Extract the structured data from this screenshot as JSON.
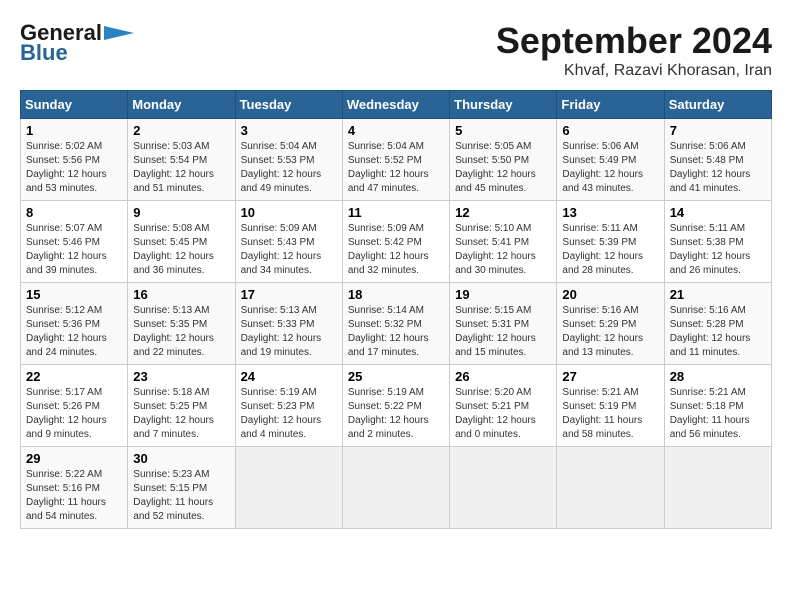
{
  "logo": {
    "general": "General",
    "blue": "Blue"
  },
  "title": "September 2024",
  "subtitle": "Khvaf, Razavi Khorasan, Iran",
  "days_header": [
    "Sunday",
    "Monday",
    "Tuesday",
    "Wednesday",
    "Thursday",
    "Friday",
    "Saturday"
  ],
  "weeks": [
    [
      {
        "day": "1",
        "sunrise": "5:02 AM",
        "sunset": "5:56 PM",
        "daylight": "12 hours and 53 minutes."
      },
      {
        "day": "2",
        "sunrise": "5:03 AM",
        "sunset": "5:54 PM",
        "daylight": "12 hours and 51 minutes."
      },
      {
        "day": "3",
        "sunrise": "5:04 AM",
        "sunset": "5:53 PM",
        "daylight": "12 hours and 49 minutes."
      },
      {
        "day": "4",
        "sunrise": "5:04 AM",
        "sunset": "5:52 PM",
        "daylight": "12 hours and 47 minutes."
      },
      {
        "day": "5",
        "sunrise": "5:05 AM",
        "sunset": "5:50 PM",
        "daylight": "12 hours and 45 minutes."
      },
      {
        "day": "6",
        "sunrise": "5:06 AM",
        "sunset": "5:49 PM",
        "daylight": "12 hours and 43 minutes."
      },
      {
        "day": "7",
        "sunrise": "5:06 AM",
        "sunset": "5:48 PM",
        "daylight": "12 hours and 41 minutes."
      }
    ],
    [
      {
        "day": "8",
        "sunrise": "5:07 AM",
        "sunset": "5:46 PM",
        "daylight": "12 hours and 39 minutes."
      },
      {
        "day": "9",
        "sunrise": "5:08 AM",
        "sunset": "5:45 PM",
        "daylight": "12 hours and 36 minutes."
      },
      {
        "day": "10",
        "sunrise": "5:09 AM",
        "sunset": "5:43 PM",
        "daylight": "12 hours and 34 minutes."
      },
      {
        "day": "11",
        "sunrise": "5:09 AM",
        "sunset": "5:42 PM",
        "daylight": "12 hours and 32 minutes."
      },
      {
        "day": "12",
        "sunrise": "5:10 AM",
        "sunset": "5:41 PM",
        "daylight": "12 hours and 30 minutes."
      },
      {
        "day": "13",
        "sunrise": "5:11 AM",
        "sunset": "5:39 PM",
        "daylight": "12 hours and 28 minutes."
      },
      {
        "day": "14",
        "sunrise": "5:11 AM",
        "sunset": "5:38 PM",
        "daylight": "12 hours and 26 minutes."
      }
    ],
    [
      {
        "day": "15",
        "sunrise": "5:12 AM",
        "sunset": "5:36 PM",
        "daylight": "12 hours and 24 minutes."
      },
      {
        "day": "16",
        "sunrise": "5:13 AM",
        "sunset": "5:35 PM",
        "daylight": "12 hours and 22 minutes."
      },
      {
        "day": "17",
        "sunrise": "5:13 AM",
        "sunset": "5:33 PM",
        "daylight": "12 hours and 19 minutes."
      },
      {
        "day": "18",
        "sunrise": "5:14 AM",
        "sunset": "5:32 PM",
        "daylight": "12 hours and 17 minutes."
      },
      {
        "day": "19",
        "sunrise": "5:15 AM",
        "sunset": "5:31 PM",
        "daylight": "12 hours and 15 minutes."
      },
      {
        "day": "20",
        "sunrise": "5:16 AM",
        "sunset": "5:29 PM",
        "daylight": "12 hours and 13 minutes."
      },
      {
        "day": "21",
        "sunrise": "5:16 AM",
        "sunset": "5:28 PM",
        "daylight": "12 hours and 11 minutes."
      }
    ],
    [
      {
        "day": "22",
        "sunrise": "5:17 AM",
        "sunset": "5:26 PM",
        "daylight": "12 hours and 9 minutes."
      },
      {
        "day": "23",
        "sunrise": "5:18 AM",
        "sunset": "5:25 PM",
        "daylight": "12 hours and 7 minutes."
      },
      {
        "day": "24",
        "sunrise": "5:19 AM",
        "sunset": "5:23 PM",
        "daylight": "12 hours and 4 minutes."
      },
      {
        "day": "25",
        "sunrise": "5:19 AM",
        "sunset": "5:22 PM",
        "daylight": "12 hours and 2 minutes."
      },
      {
        "day": "26",
        "sunrise": "5:20 AM",
        "sunset": "5:21 PM",
        "daylight": "12 hours and 0 minutes."
      },
      {
        "day": "27",
        "sunrise": "5:21 AM",
        "sunset": "5:19 PM",
        "daylight": "11 hours and 58 minutes."
      },
      {
        "day": "28",
        "sunrise": "5:21 AM",
        "sunset": "5:18 PM",
        "daylight": "11 hours and 56 minutes."
      }
    ],
    [
      {
        "day": "29",
        "sunrise": "5:22 AM",
        "sunset": "5:16 PM",
        "daylight": "11 hours and 54 minutes."
      },
      {
        "day": "30",
        "sunrise": "5:23 AM",
        "sunset": "5:15 PM",
        "daylight": "11 hours and 52 minutes."
      },
      null,
      null,
      null,
      null,
      null
    ]
  ]
}
